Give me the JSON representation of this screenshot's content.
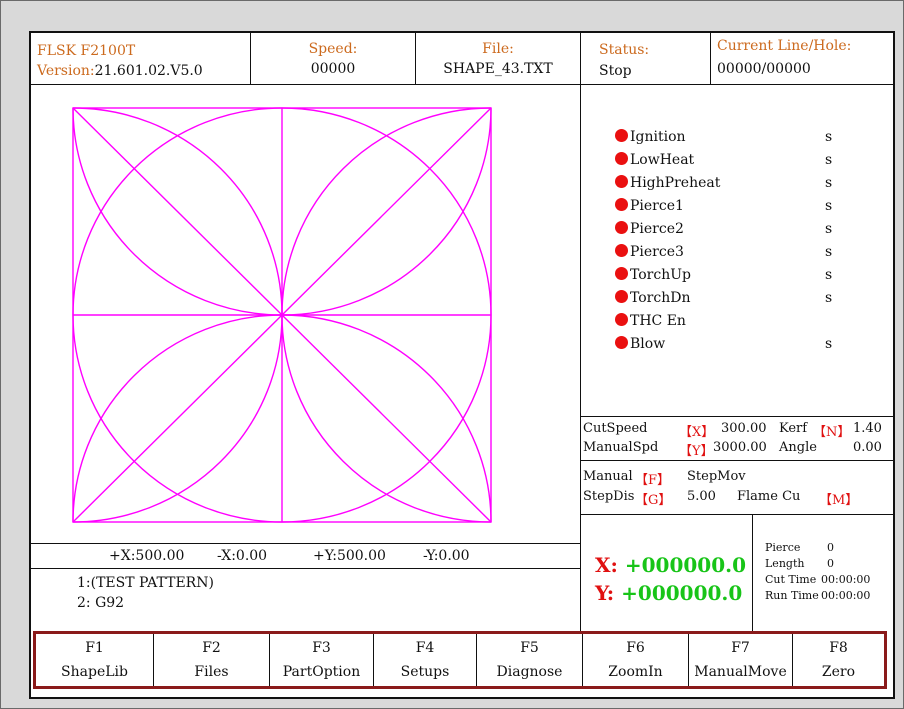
{
  "header": {
    "model": "FLSK F2100T",
    "version_label": "Version:",
    "version_value": "21.601.02.V5.0",
    "speed_label": "Speed:",
    "speed_value": "00000",
    "file_label": "File:",
    "file_value": "SHAPE_43.TXT",
    "status_label": "Status:",
    "status_value": "Stop",
    "line_label": "Current Line/Hole:",
    "line_value": "00000/00000"
  },
  "io_list": [
    {
      "label": "Ignition",
      "unit": "s"
    },
    {
      "label": "LowHeat",
      "unit": "s"
    },
    {
      "label": "HighPreheat",
      "unit": "s"
    },
    {
      "label": "Pierce1",
      "unit": "s"
    },
    {
      "label": "Pierce2",
      "unit": "s"
    },
    {
      "label": "Pierce3",
      "unit": "s"
    },
    {
      "label": "TorchUp",
      "unit": "s"
    },
    {
      "label": "TorchDn",
      "unit": "s"
    },
    {
      "label": "THC En",
      "unit": ""
    },
    {
      "label": "Blow",
      "unit": "s"
    }
  ],
  "params": {
    "cut_speed_label": "CutSpeed",
    "cut_speed_key": "【X】",
    "cut_speed_value": "300.00",
    "kerf_label": "Kerf",
    "kerf_key": "【N】",
    "kerf_value": "1.40",
    "manual_spd_label": "ManualSpd",
    "manual_spd_key": "【Y】",
    "manual_spd_value": "3000.00",
    "angle_label": "Angle",
    "angle_value": "0.00"
  },
  "manual": {
    "manual_label": "Manual",
    "manual_key": "【F】",
    "manual_value": "StepMov",
    "stepdis_label": "StepDis",
    "stepdis_key": "【G】",
    "stepdis_value": "5.00",
    "flame_label": "Flame Cu",
    "flame_key": "【M】"
  },
  "position": {
    "x_label": "X:",
    "x_value": "+000000.0",
    "y_label": "Y:",
    "y_value": "+000000.0"
  },
  "stats": {
    "pierce_label": "Pierce",
    "pierce_value": "0",
    "length_label": "Length",
    "length_value": "0",
    "cut_time_label": "Cut Time",
    "cut_time_value": "00:00:00",
    "run_time_label": "Run Time",
    "run_time_value": "00:00:00"
  },
  "limits": {
    "x_plus": "+X:500.00",
    "x_minus": "-X:0.00",
    "y_plus": "+Y:500.00",
    "y_minus": "-Y:0.00"
  },
  "program_lines": [
    "1:(TEST PATTERN)",
    "2: G92"
  ],
  "fkeys": [
    {
      "key": "F1",
      "label": "ShapeLib"
    },
    {
      "key": "F2",
      "label": "Files"
    },
    {
      "key": "F3",
      "label": "PartOption"
    },
    {
      "key": "F4",
      "label": "Setups"
    },
    {
      "key": "F5",
      "label": "Diagnose"
    },
    {
      "key": "F6",
      "label": "ZoomIn"
    },
    {
      "key": "F7",
      "label": "ManualMove"
    },
    {
      "key": "F8",
      "label": "Zero"
    }
  ],
  "colors": {
    "pattern": "#ff00ff",
    "indicator": "#ea1010",
    "position": "#18c418",
    "header_label": "#cc6a1e",
    "fkey_border": "#8a1a1a"
  }
}
